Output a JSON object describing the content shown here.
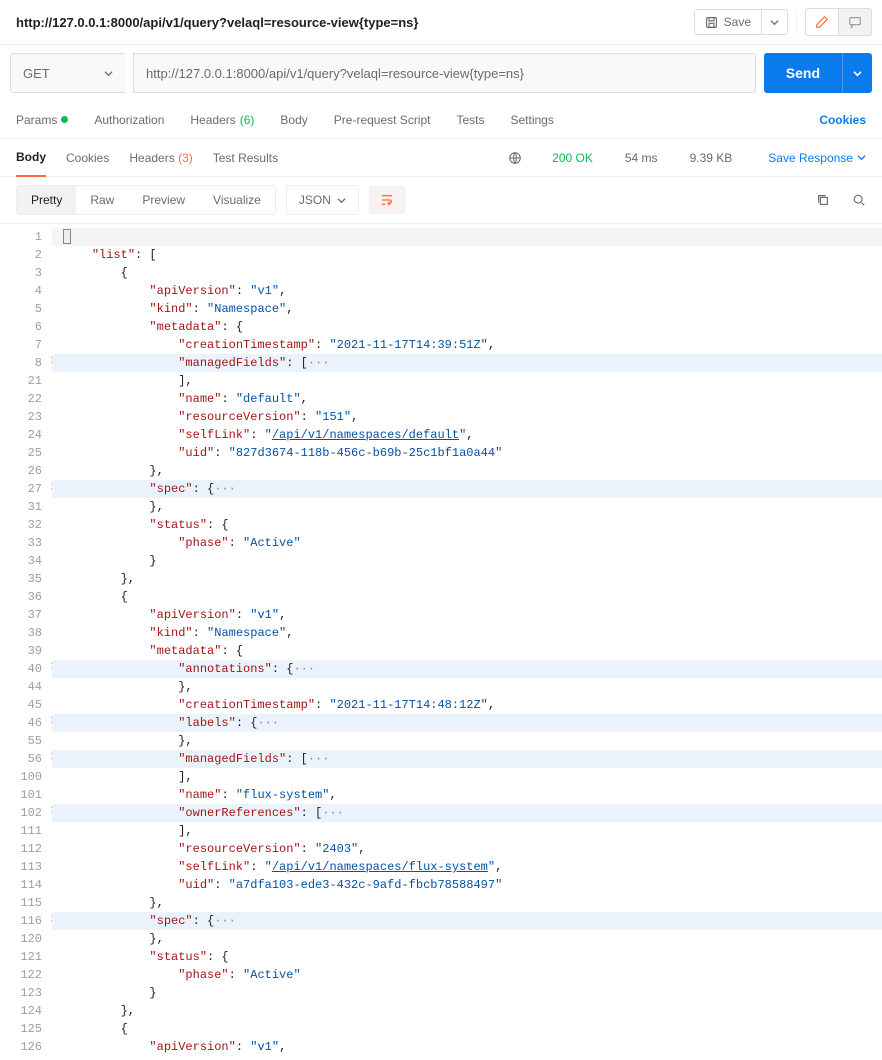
{
  "title": "http://127.0.0.1:8000/api/v1/query?velaql=resource-view{type=ns}",
  "save_label": "Save",
  "method": "GET",
  "url": "http://127.0.0.1:8000/api/v1/query?velaql=resource-view{type=ns}",
  "send_label": "Send",
  "req_tabs": {
    "params": "Params",
    "auth": "Authorization",
    "headers": "Headers",
    "headers_count": "(6)",
    "body": "Body",
    "prerequest": "Pre-request Script",
    "tests": "Tests",
    "settings": "Settings"
  },
  "cookies_link": "Cookies",
  "resp_tabs": {
    "body": "Body",
    "cookies": "Cookies",
    "headers": "Headers",
    "headers_count": "(3)",
    "test_results": "Test Results"
  },
  "status": "200 OK",
  "time": "54 ms",
  "size": "9.39 KB",
  "save_response": "Save Response",
  "fmt": {
    "pretty": "Pretty",
    "raw": "Raw",
    "preview": "Preview",
    "visualize": "Visualize"
  },
  "json_label": "JSON",
  "code_lines": [
    {
      "n": "1",
      "cur": true,
      "c": [
        {
          "p": "{"
        }
      ],
      "cursor": true
    },
    {
      "n": "2",
      "c": [
        {
          "sp": "    "
        },
        {
          "k": "\"list\""
        },
        {
          "p": ": ["
        }
      ]
    },
    {
      "n": "3",
      "c": [
        {
          "sp": "        "
        },
        {
          "p": "{"
        }
      ]
    },
    {
      "n": "4",
      "c": [
        {
          "sp": "            "
        },
        {
          "k": "\"apiVersion\""
        },
        {
          "p": ": "
        },
        {
          "s": "\"v1\""
        },
        {
          "p": ","
        }
      ]
    },
    {
      "n": "5",
      "c": [
        {
          "sp": "            "
        },
        {
          "k": "\"kind\""
        },
        {
          "p": ": "
        },
        {
          "s": "\"Namespace\""
        },
        {
          "p": ","
        }
      ]
    },
    {
      "n": "6",
      "c": [
        {
          "sp": "            "
        },
        {
          "k": "\"metadata\""
        },
        {
          "p": ": {"
        }
      ]
    },
    {
      "n": "7",
      "c": [
        {
          "sp": "                "
        },
        {
          "k": "\"creationTimestamp\""
        },
        {
          "p": ": "
        },
        {
          "s": "\"2021-11-17T14:39:51Z\""
        },
        {
          "p": ","
        }
      ]
    },
    {
      "n": "8",
      "hl": true,
      "chev": true,
      "c": [
        {
          "sp": "                "
        },
        {
          "k": "\"managedFields\""
        },
        {
          "p": ": ["
        },
        {
          "e": "···"
        }
      ]
    },
    {
      "n": "21",
      "c": [
        {
          "sp": "                "
        },
        {
          "p": "],"
        }
      ]
    },
    {
      "n": "22",
      "c": [
        {
          "sp": "                "
        },
        {
          "k": "\"name\""
        },
        {
          "p": ": "
        },
        {
          "s": "\"default\""
        },
        {
          "p": ","
        }
      ]
    },
    {
      "n": "23",
      "c": [
        {
          "sp": "                "
        },
        {
          "k": "\"resourceVersion\""
        },
        {
          "p": ": "
        },
        {
          "s": "\"151\""
        },
        {
          "p": ","
        }
      ]
    },
    {
      "n": "24",
      "c": [
        {
          "sp": "                "
        },
        {
          "k": "\"selfLink\""
        },
        {
          "p": ": "
        },
        {
          "s": "\""
        },
        {
          "l": "/api/v1/namespaces/default"
        },
        {
          "s": "\""
        },
        {
          "p": ","
        }
      ]
    },
    {
      "n": "25",
      "c": [
        {
          "sp": "                "
        },
        {
          "k": "\"uid\""
        },
        {
          "p": ": "
        },
        {
          "s": "\"827d3674-118b-456c-b69b-25c1bf1a0a44\""
        }
      ]
    },
    {
      "n": "26",
      "c": [
        {
          "sp": "            "
        },
        {
          "p": "},"
        }
      ]
    },
    {
      "n": "27",
      "hl": true,
      "chev": true,
      "c": [
        {
          "sp": "            "
        },
        {
          "k": "\"spec\""
        },
        {
          "p": ": {"
        },
        {
          "e": "···"
        }
      ]
    },
    {
      "n": "31",
      "c": [
        {
          "sp": "            "
        },
        {
          "p": "},"
        }
      ]
    },
    {
      "n": "32",
      "c": [
        {
          "sp": "            "
        },
        {
          "k": "\"status\""
        },
        {
          "p": ": {"
        }
      ]
    },
    {
      "n": "33",
      "c": [
        {
          "sp": "                "
        },
        {
          "k": "\"phase\""
        },
        {
          "p": ": "
        },
        {
          "s": "\"Active\""
        }
      ]
    },
    {
      "n": "34",
      "c": [
        {
          "sp": "            "
        },
        {
          "p": "}"
        }
      ]
    },
    {
      "n": "35",
      "c": [
        {
          "sp": "        "
        },
        {
          "p": "},"
        }
      ]
    },
    {
      "n": "36",
      "c": [
        {
          "sp": "        "
        },
        {
          "p": "{"
        }
      ]
    },
    {
      "n": "37",
      "c": [
        {
          "sp": "            "
        },
        {
          "k": "\"apiVersion\""
        },
        {
          "p": ": "
        },
        {
          "s": "\"v1\""
        },
        {
          "p": ","
        }
      ]
    },
    {
      "n": "38",
      "c": [
        {
          "sp": "            "
        },
        {
          "k": "\"kind\""
        },
        {
          "p": ": "
        },
        {
          "s": "\"Namespace\""
        },
        {
          "p": ","
        }
      ]
    },
    {
      "n": "39",
      "c": [
        {
          "sp": "            "
        },
        {
          "k": "\"metadata\""
        },
        {
          "p": ": {"
        }
      ]
    },
    {
      "n": "40",
      "hl": true,
      "chev": true,
      "c": [
        {
          "sp": "                "
        },
        {
          "k": "\"annotations\""
        },
        {
          "p": ": {"
        },
        {
          "e": "···"
        }
      ]
    },
    {
      "n": "44",
      "c": [
        {
          "sp": "                "
        },
        {
          "p": "},"
        }
      ]
    },
    {
      "n": "45",
      "c": [
        {
          "sp": "                "
        },
        {
          "k": "\"creationTimestamp\""
        },
        {
          "p": ": "
        },
        {
          "s": "\"2021-11-17T14:48:12Z\""
        },
        {
          "p": ","
        }
      ]
    },
    {
      "n": "46",
      "hl": true,
      "chev": true,
      "c": [
        {
          "sp": "                "
        },
        {
          "k": "\"labels\""
        },
        {
          "p": ": {"
        },
        {
          "e": "···"
        }
      ]
    },
    {
      "n": "55",
      "c": [
        {
          "sp": "                "
        },
        {
          "p": "},"
        }
      ]
    },
    {
      "n": "56",
      "hl": true,
      "chev": true,
      "c": [
        {
          "sp": "                "
        },
        {
          "k": "\"managedFields\""
        },
        {
          "p": ": ["
        },
        {
          "e": "···"
        }
      ]
    },
    {
      "n": "100",
      "c": [
        {
          "sp": "                "
        },
        {
          "p": "],"
        }
      ]
    },
    {
      "n": "101",
      "c": [
        {
          "sp": "                "
        },
        {
          "k": "\"name\""
        },
        {
          "p": ": "
        },
        {
          "s": "\"flux-system\""
        },
        {
          "p": ","
        }
      ]
    },
    {
      "n": "102",
      "hl": true,
      "chev": true,
      "c": [
        {
          "sp": "                "
        },
        {
          "k": "\"ownerReferences\""
        },
        {
          "p": ": ["
        },
        {
          "e": "···"
        }
      ]
    },
    {
      "n": "111",
      "c": [
        {
          "sp": "                "
        },
        {
          "p": "],"
        }
      ]
    },
    {
      "n": "112",
      "c": [
        {
          "sp": "                "
        },
        {
          "k": "\"resourceVersion\""
        },
        {
          "p": ": "
        },
        {
          "s": "\"2403\""
        },
        {
          "p": ","
        }
      ]
    },
    {
      "n": "113",
      "c": [
        {
          "sp": "                "
        },
        {
          "k": "\"selfLink\""
        },
        {
          "p": ": "
        },
        {
          "s": "\""
        },
        {
          "l": "/api/v1/namespaces/flux-system"
        },
        {
          "s": "\""
        },
        {
          "p": ","
        }
      ]
    },
    {
      "n": "114",
      "c": [
        {
          "sp": "                "
        },
        {
          "k": "\"uid\""
        },
        {
          "p": ": "
        },
        {
          "s": "\"a7dfa103-ede3-432c-9afd-fbcb78588497\""
        }
      ]
    },
    {
      "n": "115",
      "c": [
        {
          "sp": "            "
        },
        {
          "p": "},"
        }
      ]
    },
    {
      "n": "116",
      "hl": true,
      "chev": true,
      "c": [
        {
          "sp": "            "
        },
        {
          "k": "\"spec\""
        },
        {
          "p": ": {"
        },
        {
          "e": "···"
        }
      ]
    },
    {
      "n": "120",
      "c": [
        {
          "sp": "            "
        },
        {
          "p": "},"
        }
      ]
    },
    {
      "n": "121",
      "c": [
        {
          "sp": "            "
        },
        {
          "k": "\"status\""
        },
        {
          "p": ": {"
        }
      ]
    },
    {
      "n": "122",
      "c": [
        {
          "sp": "                "
        },
        {
          "k": "\"phase\""
        },
        {
          "p": ": "
        },
        {
          "s": "\"Active\""
        }
      ]
    },
    {
      "n": "123",
      "c": [
        {
          "sp": "            "
        },
        {
          "p": "}"
        }
      ]
    },
    {
      "n": "124",
      "c": [
        {
          "sp": "        "
        },
        {
          "p": "},"
        }
      ]
    },
    {
      "n": "125",
      "c": [
        {
          "sp": "        "
        },
        {
          "p": "{"
        }
      ]
    },
    {
      "n": "126",
      "c": [
        {
          "sp": "            "
        },
        {
          "k": "\"apiVersion\""
        },
        {
          "p": ": "
        },
        {
          "s": "\"v1\""
        },
        {
          "p": ","
        }
      ]
    }
  ]
}
